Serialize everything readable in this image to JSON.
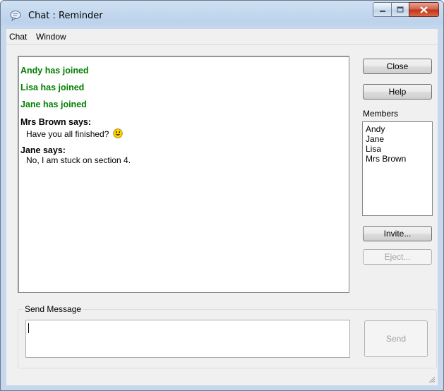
{
  "window": {
    "title": "Chat : Reminder"
  },
  "menu": {
    "items": [
      "Chat",
      "Window"
    ]
  },
  "chat_log": {
    "joined": [
      "Andy has joined",
      "Lisa has joined",
      "Jane has joined"
    ],
    "messages": [
      {
        "speaker": "Mrs Brown says:",
        "text": "Have you all finished?",
        "emoticon": "smiley-icon"
      },
      {
        "speaker": "Jane says:",
        "text": "No, I am stuck on section 4."
      }
    ]
  },
  "buttons": {
    "close": "Close",
    "help": "Help",
    "invite": "Invite...",
    "eject": "Eject...",
    "send": "Send"
  },
  "members": {
    "label": "Members",
    "list": [
      "Andy",
      "Jane",
      "Lisa",
      "Mrs Brown"
    ]
  },
  "send_message": {
    "label": "Send Message",
    "value": ""
  },
  "colors": {
    "joined_text": "#008000"
  }
}
